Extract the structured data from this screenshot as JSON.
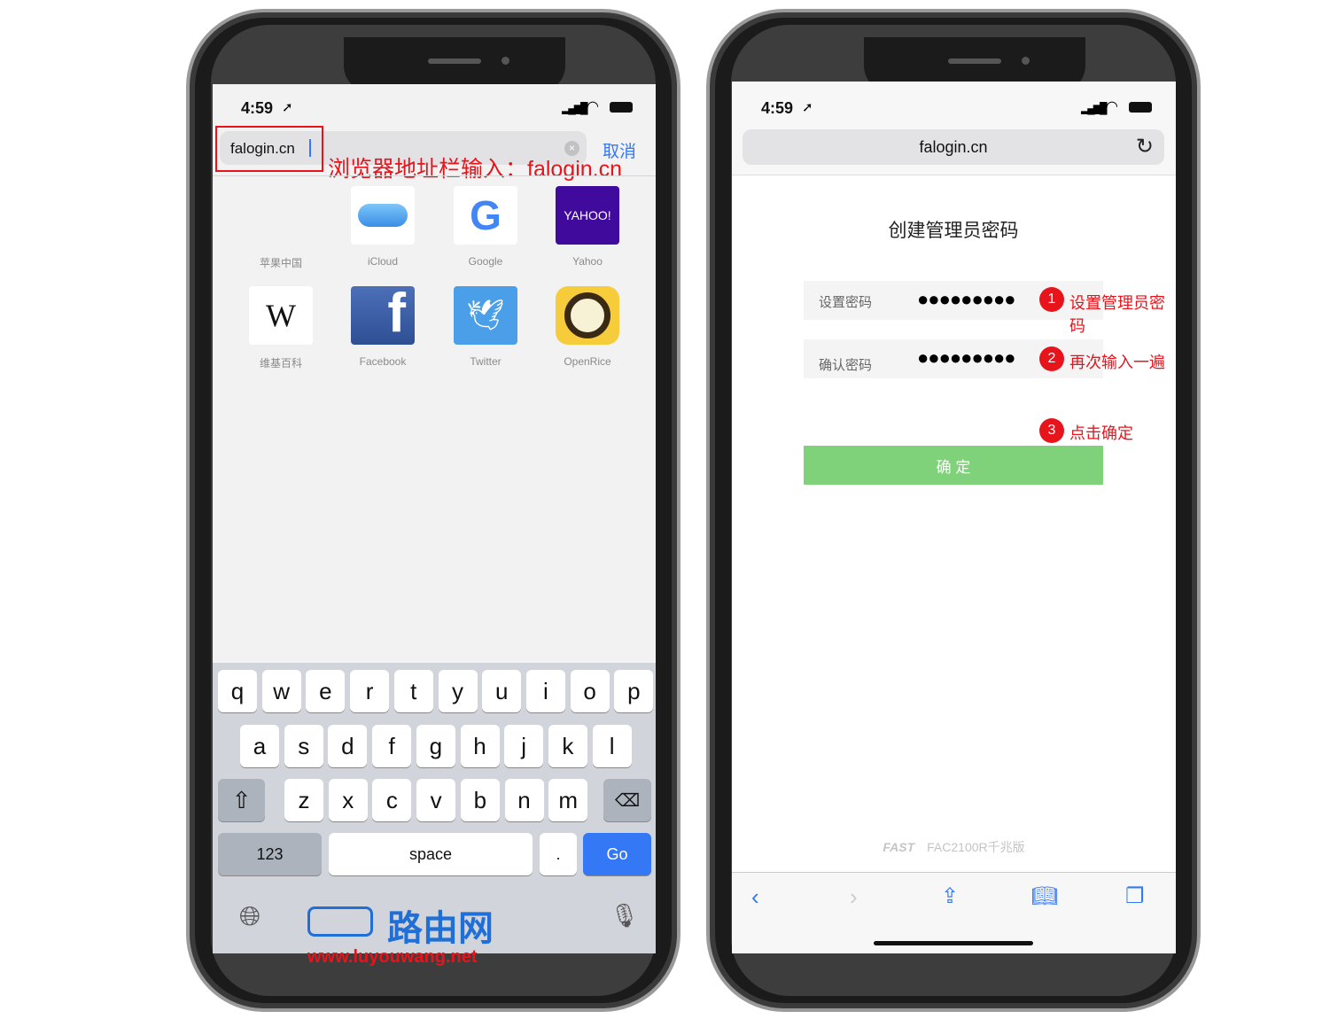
{
  "left_phone": {
    "status": {
      "time": "4:59"
    },
    "address_bar": {
      "value": "falogin.cn",
      "cancel_label": "取消"
    },
    "annotation": "浏览器地址栏输入：falogin.cn",
    "favorites": [
      {
        "label": "苹果中国",
        "icon": "apple-icon"
      },
      {
        "label": "iCloud",
        "icon": "icloud-icon"
      },
      {
        "label": "Google",
        "icon": "google-icon"
      },
      {
        "label": "Yahoo",
        "icon": "yahoo-icon",
        "tile_text": "YAHOO!"
      },
      {
        "label": "维基百科",
        "icon": "wikipedia-icon",
        "tile_text": "W"
      },
      {
        "label": "Facebook",
        "icon": "facebook-icon",
        "tile_text": "f"
      },
      {
        "label": "Twitter",
        "icon": "twitter-icon"
      },
      {
        "label": "OpenRice",
        "icon": "openrice-icon"
      }
    ],
    "keyboard": {
      "row1": [
        "q",
        "w",
        "e",
        "r",
        "t",
        "y",
        "u",
        "i",
        "o",
        "p"
      ],
      "row2": [
        "a",
        "s",
        "d",
        "f",
        "g",
        "h",
        "j",
        "k",
        "l"
      ],
      "row3": [
        "z",
        "x",
        "c",
        "v",
        "b",
        "n",
        "m"
      ],
      "numbers_label": "123",
      "space_label": "space",
      "period_label": ".",
      "go_label": "Go"
    },
    "watermark": {
      "text": "路由网",
      "url": "www.luyouwang.net"
    }
  },
  "right_phone": {
    "status": {
      "time": "4:59"
    },
    "address_bar": {
      "value": "falogin.cn"
    },
    "page_title": "创建管理员密码",
    "fields": [
      {
        "label": "设置密码",
        "value": "●●●●●●●●●",
        "step": "1",
        "annotation": "设置管理员密码"
      },
      {
        "label": "确认密码",
        "value": "●●●●●●●●●",
        "step": "2",
        "annotation": "再次输入一遍"
      }
    ],
    "confirm_step": {
      "step": "3",
      "annotation": "点击确定"
    },
    "confirm_button": "确 定",
    "footer": {
      "brand": "FAST",
      "model": "FAC2100R千兆版"
    }
  },
  "colors": {
    "annotation_red": "#e8141c",
    "ios_blue": "#3478f6",
    "confirm_green": "#7fd17a"
  }
}
